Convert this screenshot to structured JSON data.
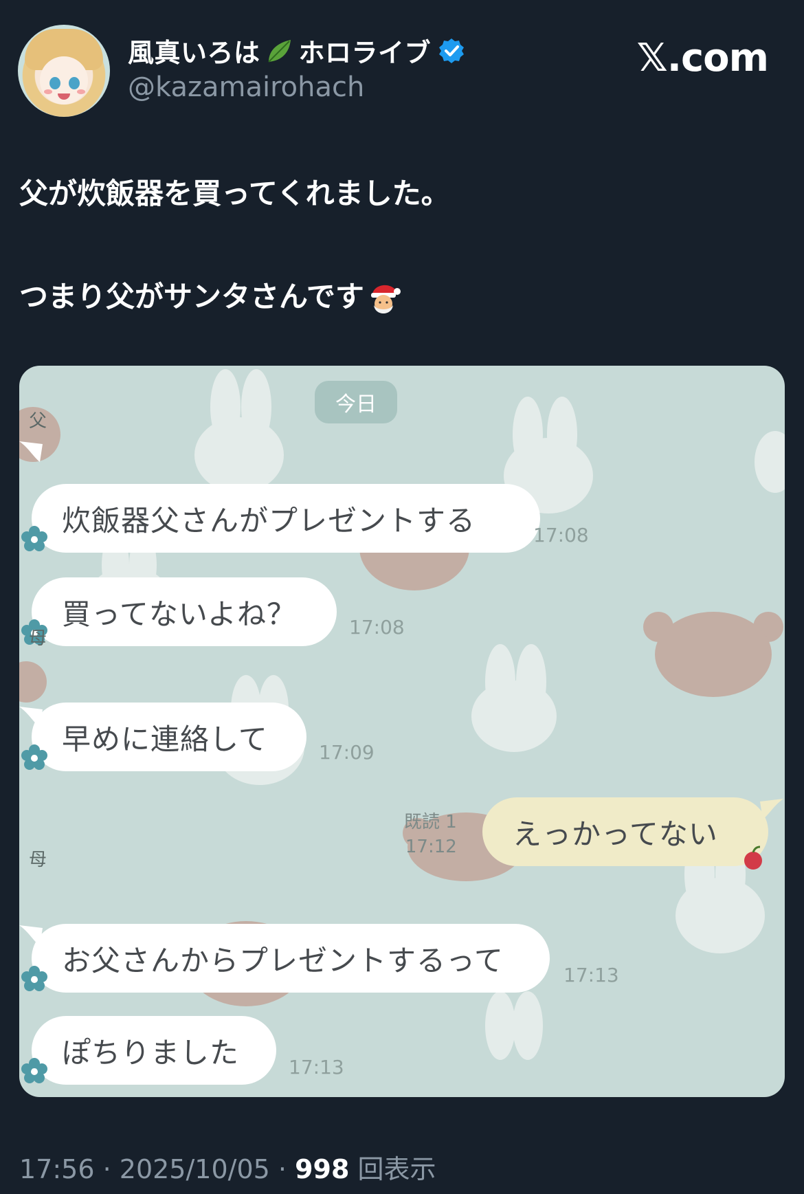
{
  "header": {
    "display_name": "風真いろは",
    "display_suffix": "ホロライブ",
    "handle": "@kazamairohach",
    "site": "𝕏.com"
  },
  "tweet": {
    "line1": "父が炊飯器を買ってくれました。",
    "line2": "つまり父がサンタさんです"
  },
  "chat": {
    "date_label": "今日",
    "messages": [
      {
        "sender": "父",
        "text": "炊飯器父さんがプレゼントする",
        "time": "17:08"
      },
      {
        "sender": "",
        "text": "買ってないよね？",
        "time": "17:08"
      },
      {
        "sender": "母",
        "text": "早めに連絡して",
        "time": "17:09"
      },
      {
        "sender": "me",
        "text": "えっかってない",
        "read": "既読 1",
        "time": "17:12"
      },
      {
        "sender": "母",
        "text": "お父さんからプレゼントするって",
        "time": "17:13"
      },
      {
        "sender": "",
        "text": "ぽちりました",
        "time": "17:13"
      }
    ]
  },
  "footer": {
    "time": "17:56",
    "date": "2025/10/05",
    "views": "998",
    "views_label": "回表示"
  },
  "colors": {
    "background": "#17202b",
    "chat_background": "#c7dad7",
    "verified": "#1d9bf0",
    "my_bubble": "#f0ebc8"
  }
}
